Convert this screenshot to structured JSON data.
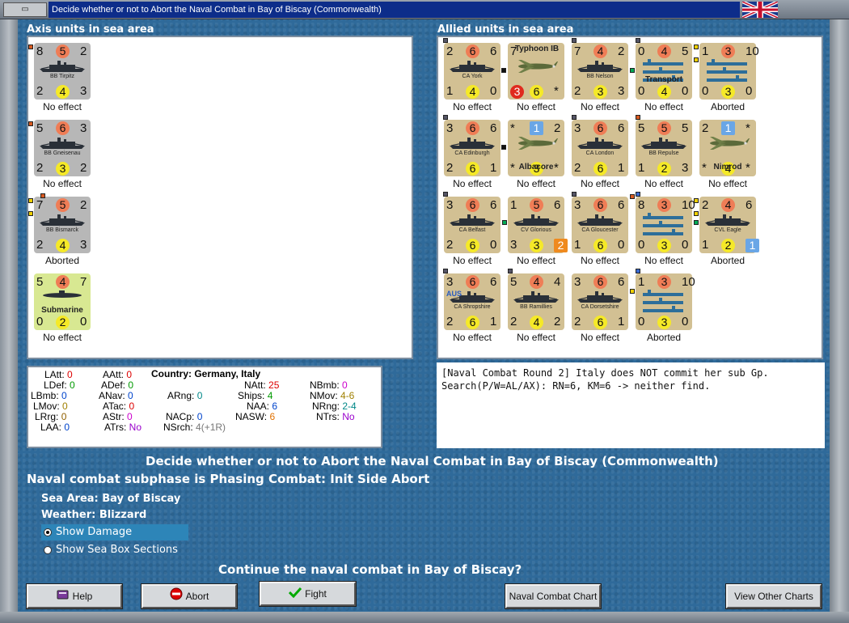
{
  "window": {
    "title": "Decide whether or not to Abort the Naval Combat in Bay of Biscay (Commonwealth)"
  },
  "axis": {
    "label": "Axis units in sea area",
    "units": [
      {
        "name": "BB Tirpitz",
        "tl": "8",
        "tc": "5",
        "tr": "2",
        "bl": "2",
        "bc": "4",
        "br": "3",
        "status": "No effect"
      },
      {
        "name": "BB Gneisenau",
        "tl": "5",
        "tc": "6",
        "tr": "3",
        "bl": "2",
        "bc": "3",
        "br": "2",
        "status": "No effect"
      },
      {
        "name": "BB Bismarck",
        "tl": "7",
        "tc": "5",
        "tr": "2",
        "bl": "2",
        "bc": "4",
        "br": "3",
        "status": "Aborted"
      },
      {
        "name": "Submarine",
        "tl": "5",
        "tc": "4",
        "tr": "7",
        "bl": "0",
        "bc": "2",
        "br": "0",
        "status": "No effect"
      }
    ]
  },
  "allied": {
    "label": "Allied units in sea area",
    "units": [
      {
        "name": "CA York",
        "tl": "2",
        "tc": "6",
        "tr": "6",
        "bl": "1",
        "bc": "4",
        "br": "0",
        "status": "No effect"
      },
      {
        "name": "Typhoon IB",
        "tl": "7",
        "tc": "",
        "tr": "",
        "bl": "3",
        "bc": "6",
        "br": "*",
        "status": "No effect"
      },
      {
        "name": "BB Nelson",
        "tl": "7",
        "tc": "4",
        "tr": "2",
        "bl": "2",
        "bc": "3",
        "br": "3",
        "status": "No effect"
      },
      {
        "name": "Transport",
        "tl": "0",
        "tc": "4",
        "tr": "5",
        "bl": "0",
        "bc": "4",
        "br": "0",
        "status": "No effect"
      },
      {
        "name": "",
        "tl": "1",
        "tc": "3",
        "tr": "10",
        "bl": "0",
        "bc": "3",
        "br": "0",
        "status": "Aborted"
      },
      {
        "name": "CA Edinburgh",
        "tl": "3",
        "tc": "6",
        "tr": "6",
        "bl": "2",
        "bc": "6",
        "br": "1",
        "status": "No effect"
      },
      {
        "name": "Albacore",
        "tl": "*",
        "tc": "1",
        "tr": "2",
        "bl": "*",
        "bc": "3",
        "br": "*",
        "status": "No effect"
      },
      {
        "name": "CA London",
        "tl": "3",
        "tc": "6",
        "tr": "6",
        "bl": "2",
        "bc": "6",
        "br": "1",
        "status": "No effect"
      },
      {
        "name": "BB Repulse",
        "tl": "5",
        "tc": "5",
        "tr": "5",
        "bl": "1",
        "bc": "2",
        "br": "3",
        "status": "No effect"
      },
      {
        "name": "Nimrod",
        "tl": "2",
        "tc": "1",
        "tr": "*",
        "bl": "*",
        "bc": "4",
        "br": "*",
        "status": "No effect"
      },
      {
        "name": "CA Belfast",
        "tl": "3",
        "tc": "6",
        "tr": "6",
        "bl": "2",
        "bc": "6",
        "br": "0",
        "status": "No effect"
      },
      {
        "name": "CV Glorious",
        "tl": "1",
        "tc": "5",
        "tr": "6",
        "bl": "3",
        "bc": "3",
        "br": "2",
        "status": "No effect"
      },
      {
        "name": "CA Gloucester",
        "tl": "3",
        "tc": "6",
        "tr": "6",
        "bl": "1",
        "bc": "6",
        "br": "0",
        "status": "No effect"
      },
      {
        "name": "",
        "tl": "8",
        "tc": "3",
        "tr": "10",
        "bl": "0",
        "bc": "3",
        "br": "0",
        "status": "No effect"
      },
      {
        "name": "CVL Eagle",
        "tl": "2",
        "tc": "4",
        "tr": "6",
        "bl": "1",
        "bc": "2",
        "br": "1",
        "status": "Aborted"
      },
      {
        "name": "CA Shropshire",
        "tl": "3",
        "tc": "6",
        "tr": "6",
        "bl": "2",
        "bc": "6",
        "br": "1",
        "status": "No effect",
        "tag": "AUS"
      },
      {
        "name": "BB Ramillies",
        "tl": "5",
        "tc": "4",
        "tr": "4",
        "bl": "2",
        "bc": "4",
        "br": "2",
        "status": "No effect"
      },
      {
        "name": "CA Dorsetshire",
        "tl": "3",
        "tc": "6",
        "tr": "6",
        "bl": "2",
        "bc": "6",
        "br": "1",
        "status": "No effect"
      },
      {
        "name": "",
        "tl": "1",
        "tc": "3",
        "tr": "10",
        "bl": "0",
        "bc": "3",
        "br": "0",
        "status": "Aborted"
      }
    ]
  },
  "stats": {
    "latt": "LAtt:",
    "latt_v": "0",
    "ldef": "LDef:",
    "ldef_v": "0",
    "lbmb": "LBmb:",
    "lbmb_v": "0",
    "lmov": "LMov:",
    "lmov_v": "0",
    "lrrg": "LRrg:",
    "lrrg_v": "0",
    "laa": "LAA:",
    "laa_v": "0",
    "aatt": "AAtt:",
    "aatt_v": "0",
    "adef": "ADef:",
    "adef_v": "0",
    "anav": "ANav:",
    "anav_v": "0",
    "atac": "ATac:",
    "atac_v": "0",
    "astr": "AStr:",
    "astr_v": "0",
    "atrs": "ATrs:",
    "atrs_v": "No",
    "country": "Country: Germany, Italy",
    "arng": "ARng:",
    "arng_v": "0",
    "nacp": "NACp:",
    "nacp_v": "0",
    "nsrch": "NSrch:",
    "nsrch_v": "4(+1R)",
    "natt": "NAtt:",
    "natt_v": "25",
    "ships": "Ships:",
    "ships_v": "4",
    "naa": "NAA:",
    "naa_v": "6",
    "nasw": "NASW:",
    "nasw_v": "6",
    "nbmb": "NBmb:",
    "nbmb_v": "0",
    "nmov": "NMov:",
    "nmov_v": "4-6",
    "nrng": "NRng:",
    "nrng_v": "2-4",
    "ntrs": "NTrs:",
    "ntrs_v": "No"
  },
  "log": {
    "line1": "[Naval Combat Round 2]  Italy does NOT commit her sub Gp.",
    "line2": "Search(P/W=AL/AX):  RN=6, KM=6 -> neither find."
  },
  "main": {
    "heading": "Decide whether or not to Abort the Naval Combat in Bay of Biscay (Commonwealth)",
    "subphase": "Naval combat subphase is Phasing Combat: Init Side Abort",
    "sea_area": "Sea Area:  Bay of Biscay",
    "weather": "Weather:  Blizzard",
    "opt1": "Show Damage",
    "opt2": "Show Sea Box Sections",
    "question": "Continue the naval combat in Bay of Biscay?"
  },
  "buttons": {
    "help": "Help",
    "abort": "Abort",
    "fight": "Fight",
    "chart": "Naval Combat Chart",
    "other": "View Other Charts"
  },
  "colors": {
    "title_bg": "#0d2d8a",
    "sea_bg": "#2f6a9a",
    "counter_tan": "#d2c093",
    "counter_grey": "#b7b7b7",
    "circle_orange": "#ef7d56",
    "circle_yellow": "#f5e928"
  }
}
